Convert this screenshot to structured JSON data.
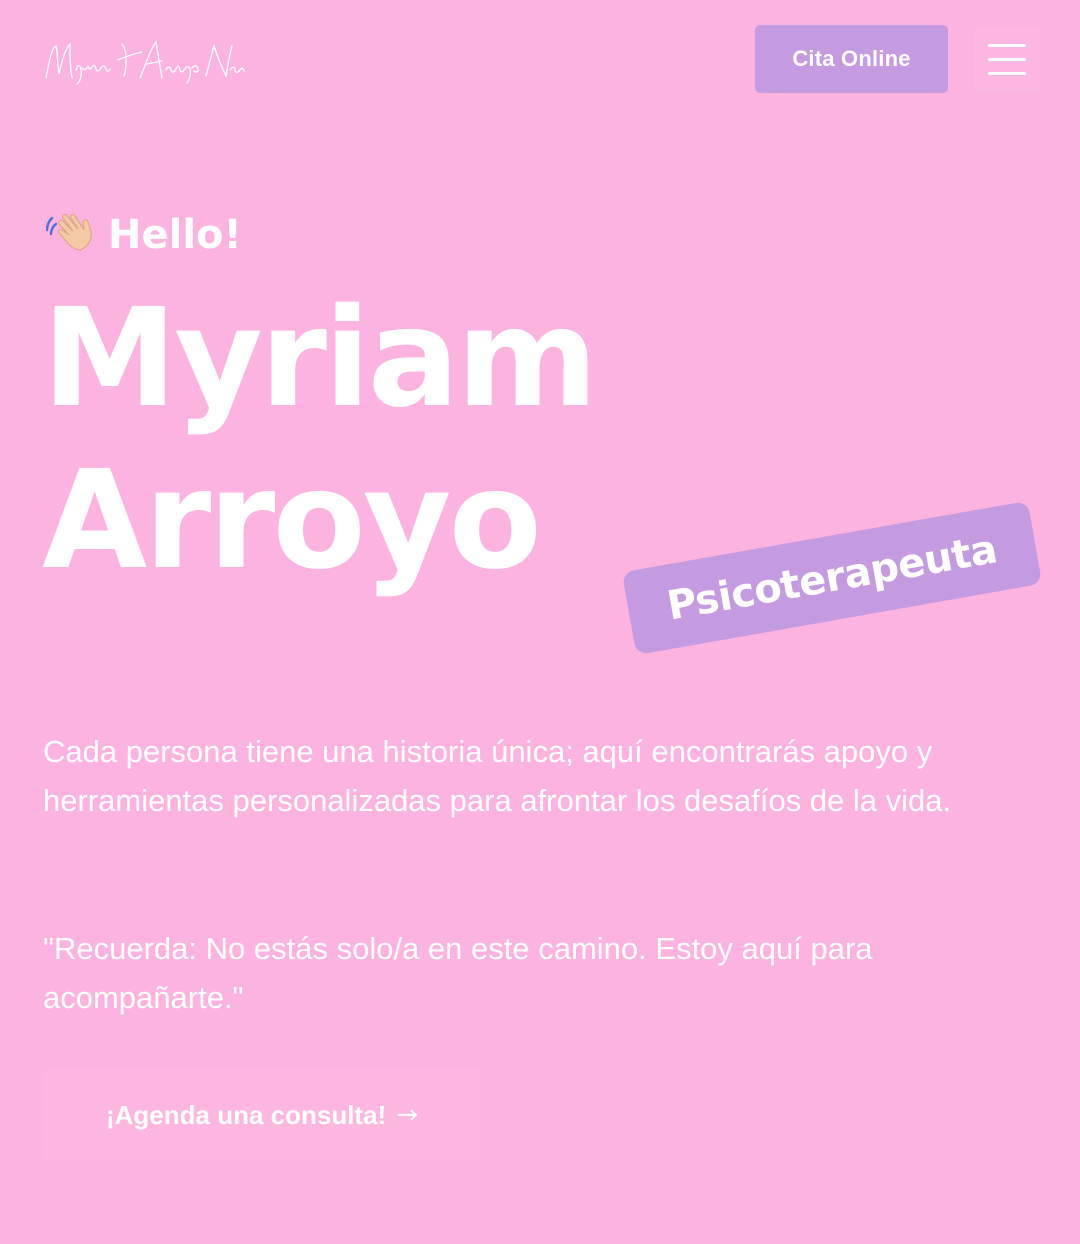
{
  "header": {
    "logo_text": "Myriam Arroyo Navas",
    "cta_label": "Cita Online",
    "menu_icon": "hamburger-menu-icon"
  },
  "hero": {
    "greeting_icon": "waving-hand-icon",
    "greeting": "Hello!",
    "name_line1": "Myriam",
    "name_line2": "Arroyo",
    "role": "Psicoterapeuta",
    "intro": "Cada persona tiene una historia única; aquí encontrarás apoyo y herramientas personalizadas para afrontar los desafíos de la vida.",
    "quote": "\"Recuerda: No estás solo/a en este camino. Estoy aquí para acompañarte.\"",
    "book_label": "¡Agenda una consulta!",
    "book_icon": "arrow-right-icon",
    "book_arrow": "→"
  },
  "colors": {
    "background": "#fcb3df",
    "accent": "#c49ae0",
    "text": "#ffffff"
  }
}
